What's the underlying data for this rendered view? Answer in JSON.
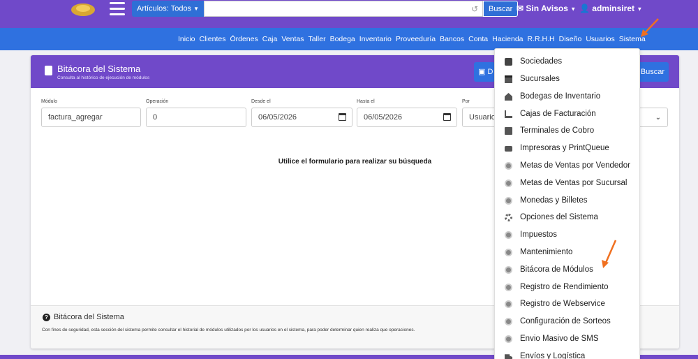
{
  "topbar": {
    "articulos_label": "Artículos: Todos",
    "search_placeholder": "",
    "search_label": "Buscar",
    "avisos_label": "Sin Avisos",
    "user_label": "adminsiret"
  },
  "menubar": {
    "items": [
      "Inicio",
      "Clientes",
      "Órdenes",
      "Caja",
      "Ventas",
      "Taller",
      "Bodega",
      "Inventario",
      "Proveeduría",
      "Bancos",
      "Conta",
      "Hacienda",
      "R.R.H.H",
      "Diseño",
      "Usuarios",
      "Sistema"
    ]
  },
  "card": {
    "title": "Bitácora del Sistema",
    "subtitle": "Consulta al histórico de ejecución de módulos",
    "header_button_1": "D",
    "header_button_2": "Buscar",
    "fields": {
      "modulo_label": "Módulo",
      "modulo_value": "factura_agregar",
      "operacion_label": "Operación",
      "operacion_value": "0",
      "desde_label": "Desde el",
      "desde_value": "06/05/2026",
      "hasta_label": "Hasta el",
      "hasta_value": "06/05/2026",
      "por_label": "Por",
      "por_value": "Usuario"
    },
    "empty_message": "Utilice el formulario para realizar su búsqueda",
    "footer_title": "Bitácora del Sistema",
    "footer_text": "Con fines de seguridad, esta sección del sistema permite consultar el historial de módulos utilizados por los usuarios en el sistema, para poder determinar quien realiza que operaciones."
  },
  "dropdown": {
    "items": [
      {
        "label": "Sociedades",
        "icon": "book-icon"
      },
      {
        "label": "Sucursales",
        "icon": "store-icon"
      },
      {
        "label": "Bodegas de Inventario",
        "icon": "warehouse-icon"
      },
      {
        "label": "Cajas de Facturación",
        "icon": "cart-icon"
      },
      {
        "label": "Terminales de Cobro",
        "icon": "terminal-icon"
      },
      {
        "label": "Impresoras y PrintQueue",
        "icon": "printer-icon"
      },
      {
        "label": "Metas de Ventas por Vendedor",
        "icon": "circle-icon"
      },
      {
        "label": "Metas de Ventas por Sucursal",
        "icon": "circle-icon"
      },
      {
        "label": "Monedas y Billetes",
        "icon": "circle-icon"
      },
      {
        "label": "Opciones del Sistema",
        "icon": "cogs-icon"
      },
      {
        "label": "Impuestos",
        "icon": "circle-icon"
      },
      {
        "label": "Mantenimiento",
        "icon": "circle-icon"
      },
      {
        "label": "Bitácora de Módulos",
        "icon": "circle-icon"
      },
      {
        "label": "Registro de Rendimiento",
        "icon": "circle-icon"
      },
      {
        "label": "Registro de Webservice",
        "icon": "circle-icon"
      },
      {
        "label": "Configuración de Sorteos",
        "icon": "circle-icon"
      },
      {
        "label": "Envio Masivo de SMS",
        "icon": "circle-icon"
      },
      {
        "label": "Envíos y Logística",
        "icon": "truck-icon"
      }
    ]
  },
  "colors": {
    "purple": "#7049c9",
    "blue": "#2f71e0",
    "arrow": "#f07020"
  }
}
